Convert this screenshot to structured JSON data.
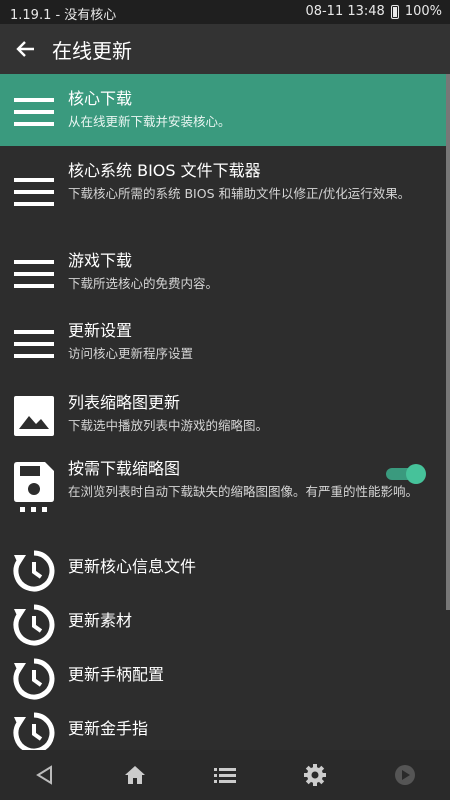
{
  "status_bar": {
    "left_text": "1.19.1 - 没有核心",
    "datetime": "08-11 13:48",
    "battery": "100%"
  },
  "toolbar": {
    "title": "在线更新"
  },
  "items": [
    {
      "title": "核心下载",
      "subtitle": "从在线更新下载并安装核心。",
      "icon": "menu-icon",
      "active": true
    },
    {
      "title": "核心系统 BIOS 文件下载器",
      "subtitle": "下载核心所需的系统 BIOS 和辅助文件以修正/优化运行效果。",
      "icon": "menu-icon"
    },
    {
      "title": "游戏下载",
      "subtitle": "下载所选核心的免费内容。",
      "icon": "menu-icon"
    },
    {
      "title": "更新设置",
      "subtitle": "访问核心更新程序设置",
      "icon": "menu-icon"
    },
    {
      "title": "列表缩略图更新",
      "subtitle": "下载选中播放列表中游戏的缩略图。",
      "icon": "image-icon"
    },
    {
      "title": "按需下载缩略图",
      "subtitle": "在浏览列表时自动下载缺失的缩略图图像。有严重的性能影响。",
      "icon": "save-disk-icon",
      "toggle_on": true
    },
    {
      "title": "更新核心信息文件",
      "subtitle": "",
      "icon": "update-clock-icon"
    },
    {
      "title": "更新素材",
      "subtitle": "",
      "icon": "update-clock-icon"
    },
    {
      "title": "更新手柄配置",
      "subtitle": "",
      "icon": "update-clock-icon"
    },
    {
      "title": "更新金手指",
      "subtitle": "",
      "icon": "update-clock-icon"
    }
  ],
  "colors": {
    "accent": "#3a9a7e",
    "background": "#2d2d2d",
    "toggle_knob": "#46c29a"
  }
}
